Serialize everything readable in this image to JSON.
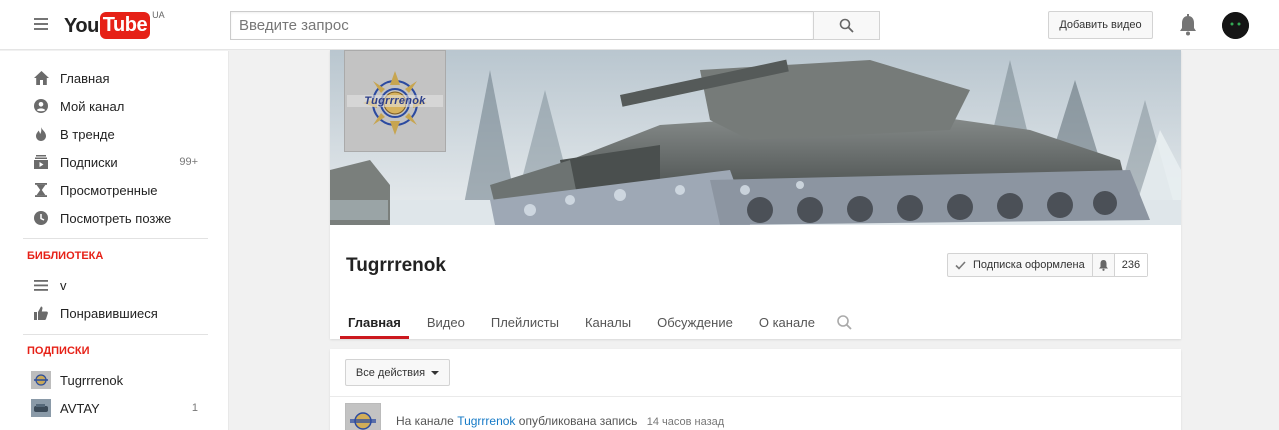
{
  "header": {
    "logo_you": "You",
    "logo_tube": "Tube",
    "region": "UA",
    "search_placeholder": "Введите запрос",
    "upload_label": "Добавить видео"
  },
  "sidebar": {
    "main_items": [
      {
        "label": "Главная",
        "icon": "home-icon"
      },
      {
        "label": "Мой канал",
        "icon": "account-icon"
      },
      {
        "label": "В тренде",
        "icon": "flame-icon"
      },
      {
        "label": "Подписки",
        "icon": "subscriptions-icon",
        "count": "99+"
      },
      {
        "label": "Просмотренные",
        "icon": "hourglass-icon"
      },
      {
        "label": "Посмотреть позже",
        "icon": "clock-icon"
      }
    ],
    "library_title": "БИБЛИОТЕКА",
    "library_items": [
      {
        "label": "v",
        "icon": "playlist-icon"
      },
      {
        "label": "Понравившиеся",
        "icon": "thumbs-up-icon"
      }
    ],
    "subscriptions_title": "ПОДПИСКИ",
    "subscriptions": [
      {
        "label": "Tugrrrenok",
        "count": ""
      },
      {
        "label": "AVTAY",
        "count": "1"
      }
    ]
  },
  "channel": {
    "name": "Tugrrrenok",
    "icon_text": "Tugrrrenok",
    "subscribe_label": "Подписка оформлена",
    "subscriber_count": "236",
    "tabs": [
      "Главная",
      "Видео",
      "Плейлисты",
      "Каналы",
      "Обсуждение",
      "О канале"
    ]
  },
  "activity": {
    "actions_label": "Все действия",
    "post_prefix": "На канале",
    "post_channel": "Tugrrrenok",
    "post_suffix": "опубликована запись",
    "post_time": "14 часов назад"
  },
  "colors": {
    "brand_red": "#e62117",
    "tab_underline": "#cc181e",
    "link_blue": "#167ac6"
  }
}
